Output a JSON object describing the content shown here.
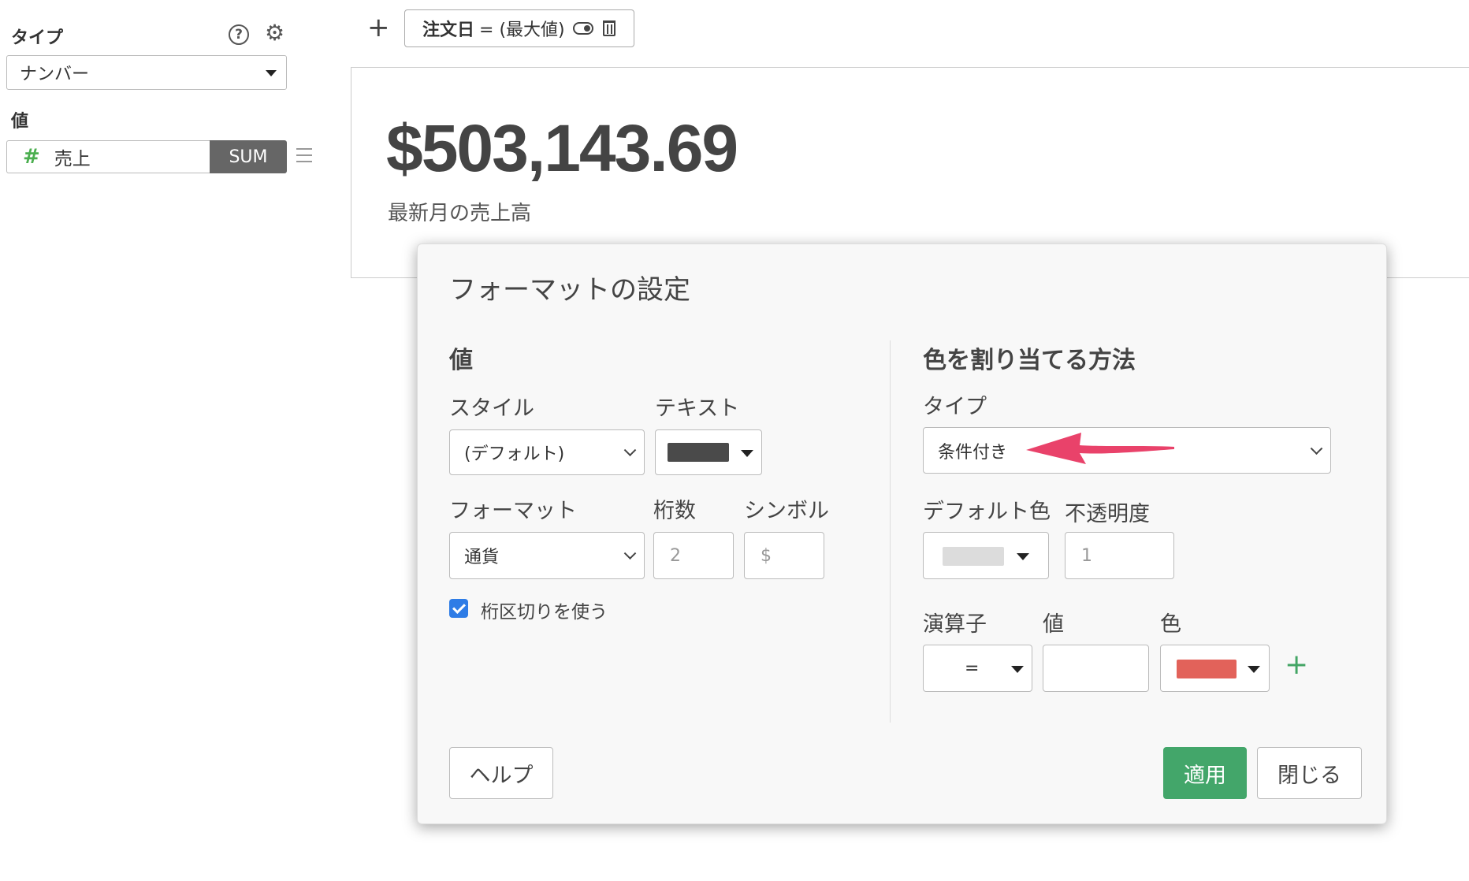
{
  "sidebar": {
    "type_label": "タイプ",
    "help_icon": "?",
    "type_select_value": "ナンバー",
    "value_label": "値",
    "field": {
      "icon": "#",
      "name": "売上",
      "aggregation": "SUM"
    }
  },
  "filter_bar": {
    "field": "注文日",
    "condition": "= (最大値)"
  },
  "number_panel": {
    "value": "$503,143.69",
    "subtitle": "最新月の売上高"
  },
  "modal": {
    "title": "フォーマットの設定",
    "value_section": {
      "heading": "値",
      "style_label": "スタイル",
      "style_value": "(デフォルト)",
      "text_label": "テキスト",
      "text_color": "#4a4a4a",
      "format_label": "フォーマット",
      "format_value": "通貨",
      "digits_label": "桁数",
      "digits_placeholder": "2",
      "symbol_label": "シンボル",
      "symbol_placeholder": "$",
      "separator_label": "桁区切りを使う",
      "separator_checked": true
    },
    "color_section": {
      "heading": "色を割り当てる方法",
      "type_label": "タイプ",
      "type_value": "条件付き",
      "default_color_label": "デフォルト色",
      "default_color": "#dcdcdc",
      "opacity_label": "不透明度",
      "opacity_placeholder": "1",
      "operator_label": "演算子",
      "operator_value": "=",
      "value_label": "値",
      "value_input": "",
      "color_label": "色",
      "condition_color": "#e2625a"
    },
    "buttons": {
      "help": "ヘルプ",
      "apply": "適用",
      "close": "閉じる"
    }
  },
  "annotation": {
    "arrow_color": "#e9426a"
  }
}
